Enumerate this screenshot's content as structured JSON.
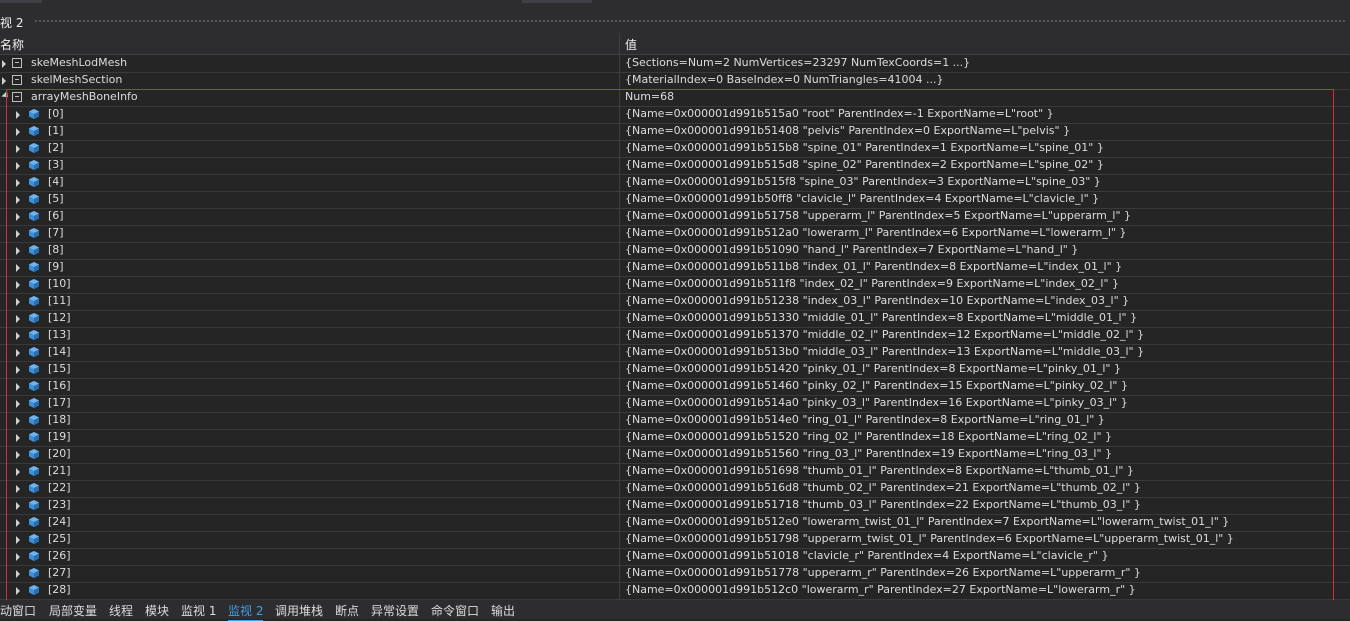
{
  "window": {
    "title": "视 2"
  },
  "columns": {
    "name": "名称",
    "value": "值"
  },
  "top_rows": [
    {
      "name": "skeMeshLodMesh",
      "value": "{Sections=Num=2 NumVertices=23297 NumTexCoords=1 ...}",
      "expanded": false
    },
    {
      "name": "skelMeshSection",
      "value": "{MaterialIndex=0 BaseIndex=0 NumTriangles=41004 ...}",
      "expanded": false
    },
    {
      "name": "arrayMeshBoneInfo",
      "value": "Num=68",
      "expanded": true
    }
  ],
  "children": [
    {
      "name": "[0]",
      "value": "{Name=0x000001d991b515a0 \"root\" ParentIndex=-1 ExportName=L\"root\" }"
    },
    {
      "name": "[1]",
      "value": "{Name=0x000001d991b51408 \"pelvis\" ParentIndex=0 ExportName=L\"pelvis\" }"
    },
    {
      "name": "[2]",
      "value": "{Name=0x000001d991b515b8 \"spine_01\" ParentIndex=1 ExportName=L\"spine_01\" }"
    },
    {
      "name": "[3]",
      "value": "{Name=0x000001d991b515d8 \"spine_02\" ParentIndex=2 ExportName=L\"spine_02\" }"
    },
    {
      "name": "[4]",
      "value": "{Name=0x000001d991b515f8 \"spine_03\" ParentIndex=3 ExportName=L\"spine_03\" }"
    },
    {
      "name": "[5]",
      "value": "{Name=0x000001d991b50ff8 \"clavicle_l\" ParentIndex=4 ExportName=L\"clavicle_l\" }"
    },
    {
      "name": "[6]",
      "value": "{Name=0x000001d991b51758 \"upperarm_l\" ParentIndex=5 ExportName=L\"upperarm_l\" }"
    },
    {
      "name": "[7]",
      "value": "{Name=0x000001d991b512a0 \"lowerarm_l\" ParentIndex=6 ExportName=L\"lowerarm_l\" }"
    },
    {
      "name": "[8]",
      "value": "{Name=0x000001d991b51090 \"hand_l\" ParentIndex=7 ExportName=L\"hand_l\" }"
    },
    {
      "name": "[9]",
      "value": "{Name=0x000001d991b511b8 \"index_01_l\" ParentIndex=8 ExportName=L\"index_01_l\" }"
    },
    {
      "name": "[10]",
      "value": "{Name=0x000001d991b511f8 \"index_02_l\" ParentIndex=9 ExportName=L\"index_02_l\" }"
    },
    {
      "name": "[11]",
      "value": "{Name=0x000001d991b51238 \"index_03_l\" ParentIndex=10 ExportName=L\"index_03_l\" }"
    },
    {
      "name": "[12]",
      "value": "{Name=0x000001d991b51330 \"middle_01_l\" ParentIndex=8 ExportName=L\"middle_01_l\" }"
    },
    {
      "name": "[13]",
      "value": "{Name=0x000001d991b51370 \"middle_02_l\" ParentIndex=12 ExportName=L\"middle_02_l\" }"
    },
    {
      "name": "[14]",
      "value": "{Name=0x000001d991b513b0 \"middle_03_l\" ParentIndex=13 ExportName=L\"middle_03_l\" }"
    },
    {
      "name": "[15]",
      "value": "{Name=0x000001d991b51420 \"pinky_01_l\" ParentIndex=8 ExportName=L\"pinky_01_l\" }"
    },
    {
      "name": "[16]",
      "value": "{Name=0x000001d991b51460 \"pinky_02_l\" ParentIndex=15 ExportName=L\"pinky_02_l\" }"
    },
    {
      "name": "[17]",
      "value": "{Name=0x000001d991b514a0 \"pinky_03_l\" ParentIndex=16 ExportName=L\"pinky_03_l\" }"
    },
    {
      "name": "[18]",
      "value": "{Name=0x000001d991b514e0 \"ring_01_l\" ParentIndex=8 ExportName=L\"ring_01_l\" }"
    },
    {
      "name": "[19]",
      "value": "{Name=0x000001d991b51520 \"ring_02_l\" ParentIndex=18 ExportName=L\"ring_02_l\" }"
    },
    {
      "name": "[20]",
      "value": "{Name=0x000001d991b51560 \"ring_03_l\" ParentIndex=19 ExportName=L\"ring_03_l\" }"
    },
    {
      "name": "[21]",
      "value": "{Name=0x000001d991b51698 \"thumb_01_l\" ParentIndex=8 ExportName=L\"thumb_01_l\" }"
    },
    {
      "name": "[22]",
      "value": "{Name=0x000001d991b516d8 \"thumb_02_l\" ParentIndex=21 ExportName=L\"thumb_02_l\" }"
    },
    {
      "name": "[23]",
      "value": "{Name=0x000001d991b51718 \"thumb_03_l\" ParentIndex=22 ExportName=L\"thumb_03_l\" }"
    },
    {
      "name": "[24]",
      "value": "{Name=0x000001d991b512e0 \"lowerarm_twist_01_l\" ParentIndex=7 ExportName=L\"lowerarm_twist_01_l\" }"
    },
    {
      "name": "[25]",
      "value": "{Name=0x000001d991b51798 \"upperarm_twist_01_l\" ParentIndex=6 ExportName=L\"upperarm_twist_01_l\" }"
    },
    {
      "name": "[26]",
      "value": "{Name=0x000001d991b51018 \"clavicle_r\" ParentIndex=4 ExportName=L\"clavicle_r\" }"
    },
    {
      "name": "[27]",
      "value": "{Name=0x000001d991b51778 \"upperarm_r\" ParentIndex=26 ExportName=L\"upperarm_r\" }"
    },
    {
      "name": "[28]",
      "value": "{Name=0x000001d991b512c0 \"lowerarm_r\" ParentIndex=27 ExportName=L\"lowerarm_r\" }"
    }
  ],
  "bottom_tabs": [
    {
      "label": "动窗口",
      "active": false
    },
    {
      "label": "局部变量",
      "active": false
    },
    {
      "label": "线程",
      "active": false
    },
    {
      "label": "模块",
      "active": false
    },
    {
      "label": "监视 1",
      "active": false
    },
    {
      "label": "监视 2",
      "active": true
    },
    {
      "label": "调用堆栈",
      "active": false
    },
    {
      "label": "断点",
      "active": false
    },
    {
      "label": "异常设置",
      "active": false
    },
    {
      "label": "命令窗口",
      "active": false
    },
    {
      "label": "输出",
      "active": false
    }
  ],
  "colors": {
    "highlight_border": "#c8323a",
    "active_tab": "#3f9ee8",
    "cube_icon": "#3d8fd6"
  },
  "icons": {
    "struct": "struct-box-icon",
    "element": "object-cube-icon",
    "expand": "expand-arrow-icon"
  }
}
